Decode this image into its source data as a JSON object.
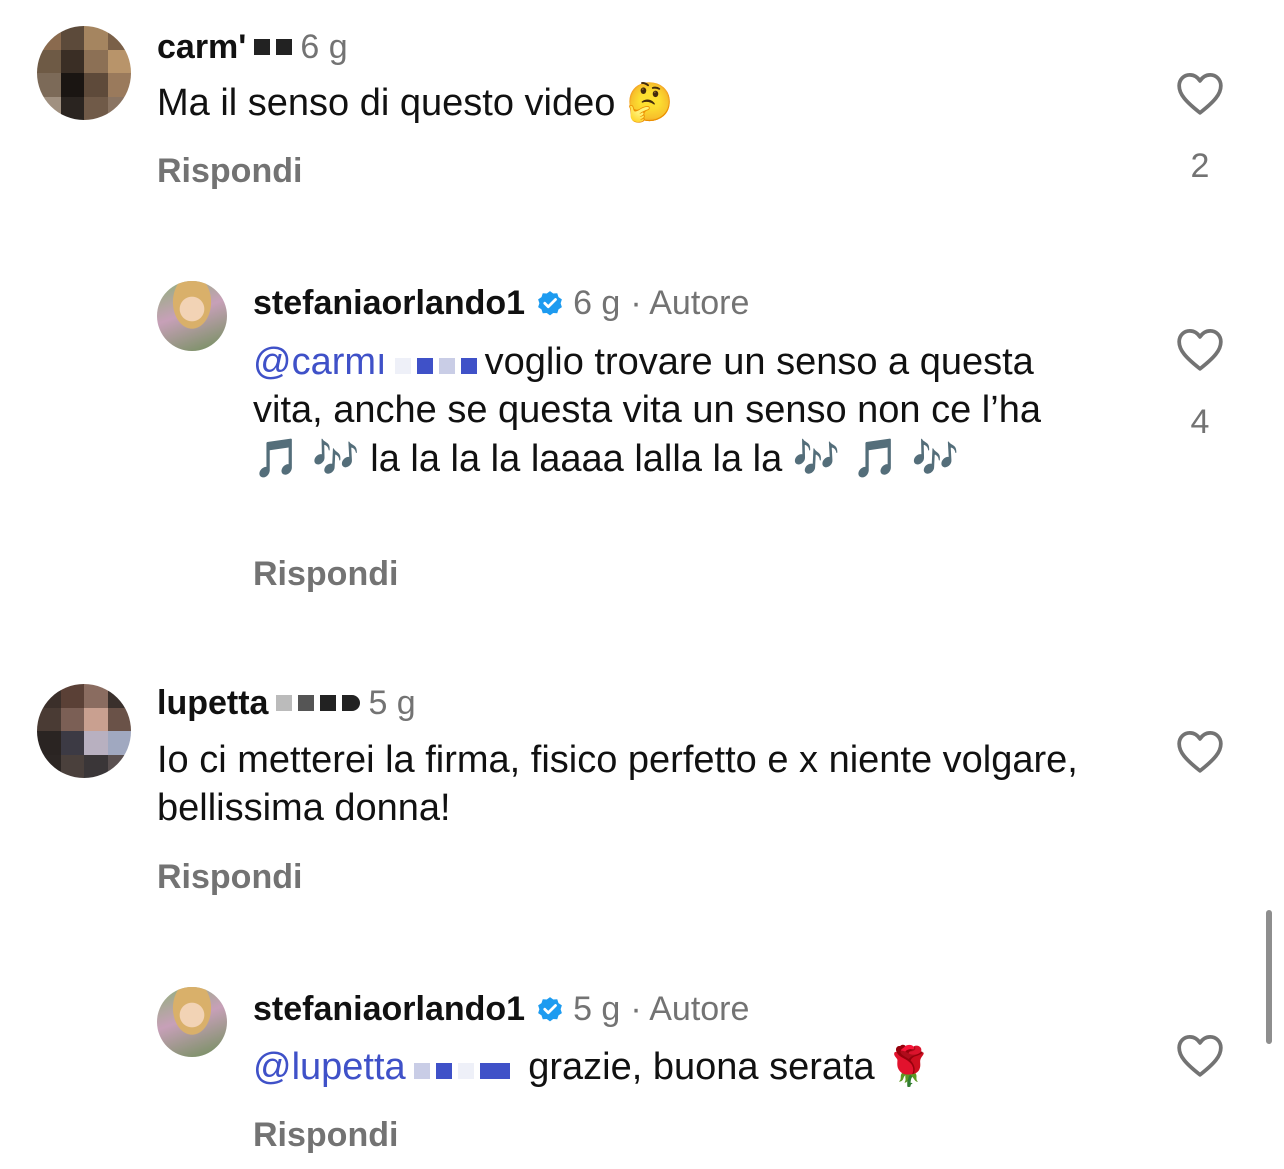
{
  "comments": [
    {
      "username": "carm'",
      "time": "6 g",
      "text": "Ma il senso di questo video",
      "emoji": "🤔",
      "reply_label": "Rispondi",
      "likes": "2"
    },
    {
      "username": "stefaniaorlando1",
      "time": "6 g",
      "author_label": "· Autore",
      "mention": "@carmı",
      "text": "voglio trovare un senso a questa vita, anche se questa vita un senso non ce l’ha",
      "emoji_tail_1": "🎵 🎶",
      "text_2": "la la la la laaaa lalla la la",
      "emoji_tail_2": "🎶 🎵 🎶",
      "reply_label": "Rispondi",
      "likes": "4"
    },
    {
      "username": "lupetta",
      "time": "5 g",
      "text": "Io ci metterei la firma, fisico perfetto e x niente volgare, bellissima donna!",
      "reply_label": "Rispondi"
    },
    {
      "username": "stefaniaorlando1",
      "time": "5 g",
      "author_label": "· Autore",
      "mention": "@lupetta",
      "text": "grazie, buona serata",
      "emoji": "🌹",
      "reply_label": "Rispondi"
    }
  ],
  "icons": {
    "like": "heart-outline-icon",
    "verified": "verified-badge-icon"
  },
  "colors": {
    "mention": "#3f51c8",
    "meta": "#737373",
    "verified": "#1d9bf0"
  }
}
